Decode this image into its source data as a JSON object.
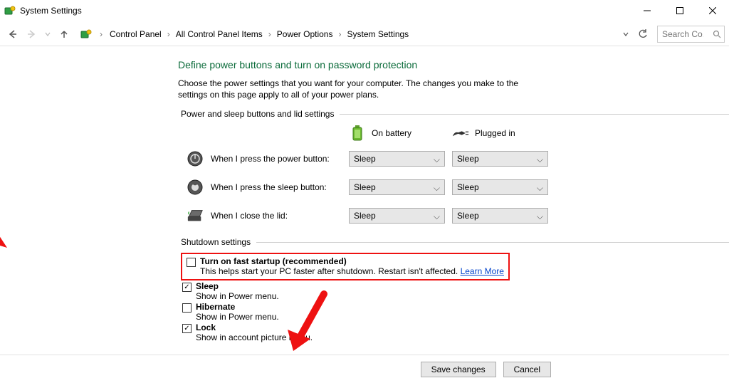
{
  "window": {
    "title": "System Settings"
  },
  "breadcrumb": {
    "items": [
      "Control Panel",
      "All Control Panel Items",
      "Power Options",
      "System Settings"
    ]
  },
  "search": {
    "placeholder": "Search Co..."
  },
  "page": {
    "title": "Define power buttons and turn on password protection",
    "subtitle": "Choose the power settings that you want for your computer. The changes you make to the settings on this page apply to all of your power plans."
  },
  "sections": {
    "buttons_label": "Power and sleep buttons and lid settings",
    "shutdown_label": "Shutdown settings"
  },
  "columns": {
    "battery": "On battery",
    "plugged": "Plugged in"
  },
  "rows": {
    "power": {
      "label": "When I press the power button:",
      "battery": "Sleep",
      "plugged": "Sleep"
    },
    "sleep": {
      "label": "When I press the sleep button:",
      "battery": "Sleep",
      "plugged": "Sleep"
    },
    "lid": {
      "label": "When I close the lid:",
      "battery": "Sleep",
      "plugged": "Sleep"
    }
  },
  "shutdown": {
    "faststartup": {
      "title": "Turn on fast startup (recommended)",
      "sub": "This helps start your PC faster after shutdown. Restart isn't affected. ",
      "link": "Learn More",
      "checked": false
    },
    "sleep": {
      "title": "Sleep",
      "sub": "Show in Power menu.",
      "checked": true
    },
    "hibernate": {
      "title": "Hibernate",
      "sub": "Show in Power menu.",
      "checked": false
    },
    "lock": {
      "title": "Lock",
      "sub": "Show in account picture menu.",
      "checked": true
    }
  },
  "buttons": {
    "save": "Save changes",
    "cancel": "Cancel"
  }
}
